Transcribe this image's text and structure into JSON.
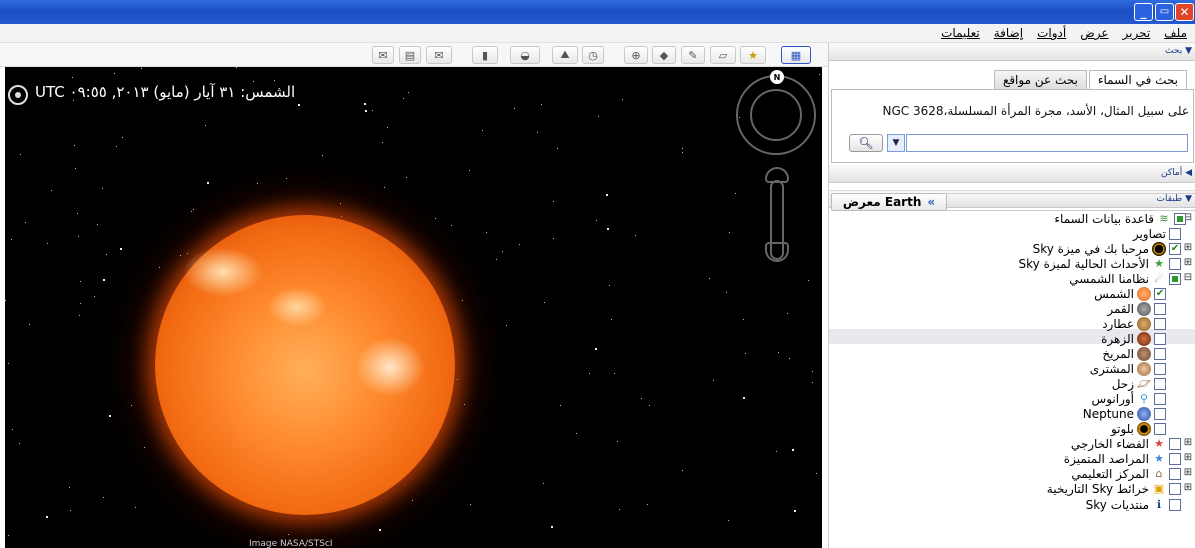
{
  "window": {
    "minimize": "_",
    "restore": "▭",
    "close": "✕"
  },
  "menu": [
    "ملف",
    "تحرير",
    "عرض",
    "أدوات",
    "إضافة",
    "تعليمات"
  ],
  "sky": {
    "info": "الشمس: ٣١ آيار (مايو) ٢٠١٣, ٠٩:٥٥ UTC",
    "credit": "Image NASA/STScI",
    "compass_north": "N"
  },
  "panel": {
    "search_header": "بحث",
    "tabs": [
      "بحث في السماء",
      "بحث عن مواقع"
    ],
    "search_hint": "على سبيل المثال، الأسد، مجرة المرأة المسلسلة،NGC 3628",
    "search_button_icon": "search-icon",
    "places_header": "أماكن",
    "layers_header": "طبقات",
    "earth_button": "معرض Earth",
    "layers": [
      {
        "label": "قاعدة بيانات السماء",
        "state": "partial",
        "expander": "⊟",
        "icon": "stack-icon"
      },
      {
        "label": "تصاوير",
        "state": "unchecked",
        "expander": "",
        "icon": ""
      },
      {
        "label": "مرحبا بك في ميزة Sky",
        "state": "checked",
        "expander": "⊞",
        "icon": "welcome-icon"
      },
      {
        "label": "الأحداث الحالية لميزة Sky",
        "state": "unchecked",
        "expander": "⊞",
        "icon": "star-icon"
      },
      {
        "label": "نظامنا الشمسي",
        "state": "partial",
        "expander": "⊟",
        "icon": "comet-icon"
      },
      {
        "label": "الشمس",
        "state": "checked",
        "expander": "",
        "icon": "sun-icon"
      },
      {
        "label": "القمر",
        "state": "unchecked",
        "expander": "",
        "icon": "moon-icon"
      },
      {
        "label": "عطارد",
        "state": "unchecked",
        "expander": "",
        "icon": "mercury-icon"
      },
      {
        "label": "الزهرة",
        "state": "unchecked",
        "expander": "",
        "icon": "venus-icon"
      },
      {
        "label": "المريخ",
        "state": "unchecked",
        "expander": "",
        "icon": "mars-icon"
      },
      {
        "label": "المشترى",
        "state": "unchecked",
        "expander": "",
        "icon": "jupiter-icon"
      },
      {
        "label": "زحل",
        "state": "unchecked",
        "expander": "",
        "icon": "saturn-icon"
      },
      {
        "label": "أورانوس",
        "state": "unchecked",
        "expander": "",
        "icon": "uranus-icon"
      },
      {
        "label": "Neptune",
        "state": "unchecked",
        "expander": "",
        "icon": "neptune-icon"
      },
      {
        "label": "بلوتو",
        "state": "unchecked",
        "expander": "",
        "icon": "pluto-icon"
      },
      {
        "label": "الفضاء الخارجي",
        "state": "unchecked",
        "expander": "⊞",
        "icon": "red-star-icon"
      },
      {
        "label": "المراصد المتميزة",
        "state": "unchecked",
        "expander": "⊞",
        "icon": "blue-star-icon"
      },
      {
        "label": "المركز التعليمي",
        "state": "unchecked",
        "expander": "⊞",
        "icon": "education-icon"
      },
      {
        "label": "خرائط Sky التاريخية",
        "state": "unchecked",
        "expander": "⊞",
        "icon": "map-icon"
      },
      {
        "label": "منتديات Sky",
        "state": "unchecked",
        "expander": "",
        "icon": "info-icon"
      }
    ]
  },
  "colors": {
    "titlebar": "#2358d0",
    "sun": "#f26a12",
    "link": "#1a3a8a"
  }
}
